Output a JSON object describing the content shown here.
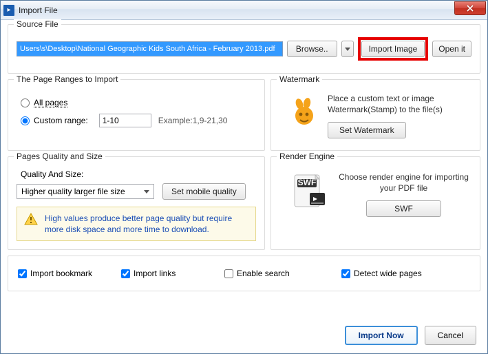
{
  "window": {
    "title": "Import File"
  },
  "source": {
    "group_title": "Source File",
    "path": "Users\\s\\Desktop\\National Geographic Kids South Africa - February 2013.pdf",
    "browse_label": "Browse..",
    "import_image_label": "Import Image",
    "open_label": "Open it"
  },
  "ranges": {
    "group_title": "The Page Ranges to Import",
    "all_label": "All pages",
    "custom_label": "Custom range:",
    "custom_value": "1-10",
    "example_label": "Example:1,9-21,30",
    "selected": "custom"
  },
  "watermark": {
    "group_title": "Watermark",
    "description": "Place a custom text or image Watermark(Stamp) to the file(s)",
    "button_label": "Set Watermark"
  },
  "quality": {
    "group_title": "Pages Quality and Size",
    "label": "Quality And Size:",
    "selected_option": "Higher quality larger file size",
    "mobile_button": "Set mobile quality",
    "info_text": "High values produce better page quality but require more disk space and more time to download."
  },
  "render": {
    "group_title": "Render Engine",
    "description": "Choose render engine for importing your PDF file",
    "button_label": "SWF"
  },
  "checks": {
    "bookmark": "Import bookmark",
    "links": "Import links",
    "search": "Enable search",
    "wide": "Detect wide pages",
    "bookmark_checked": true,
    "links_checked": true,
    "search_checked": false,
    "wide_checked": true
  },
  "footer": {
    "import_label": "Import Now",
    "cancel_label": "Cancel"
  }
}
